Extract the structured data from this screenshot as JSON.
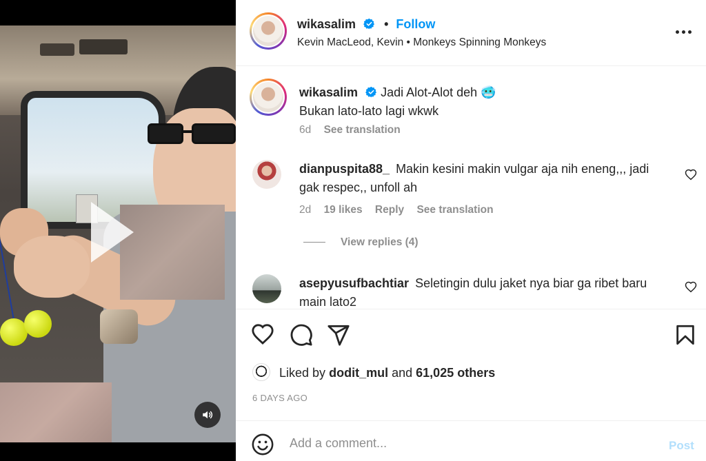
{
  "header": {
    "username": "wikasalim",
    "dot": "•",
    "follow_label": "Follow",
    "audio": "Kevin MacLeod, Kevin • Monkeys Spinning Monkeys"
  },
  "caption": {
    "username": "wikasalim",
    "line1": "Jadi Alot-Alot deh 🥶",
    "line2": "Bukan lato-lato lagi wkwk",
    "time": "6d",
    "see_translation": "See translation"
  },
  "comments": [
    {
      "username": "dianpuspita88_",
      "text": "Makin kesini makin vulgar aja nih eneng,,, jadi gak respec,, unfoll ah",
      "time": "2d",
      "likes": "19 likes",
      "reply": "Reply",
      "see_translation": "See translation",
      "view_replies": "View replies (4)"
    },
    {
      "username": "asepyusufbachtiar",
      "text": "Seletingin dulu jaket nya biar ga ribet baru main lato2"
    }
  ],
  "likes": {
    "prefix": "Liked by",
    "user": "dodit_mul",
    "and": "and",
    "others": "61,025 others"
  },
  "date": "6 DAYS AGO",
  "add_comment": {
    "placeholder": "Add a comment...",
    "post_label": "Post"
  },
  "colors": {
    "accent": "#0095f6",
    "post_disabled": "#b2dffc",
    "muted": "#8e8e8e"
  }
}
